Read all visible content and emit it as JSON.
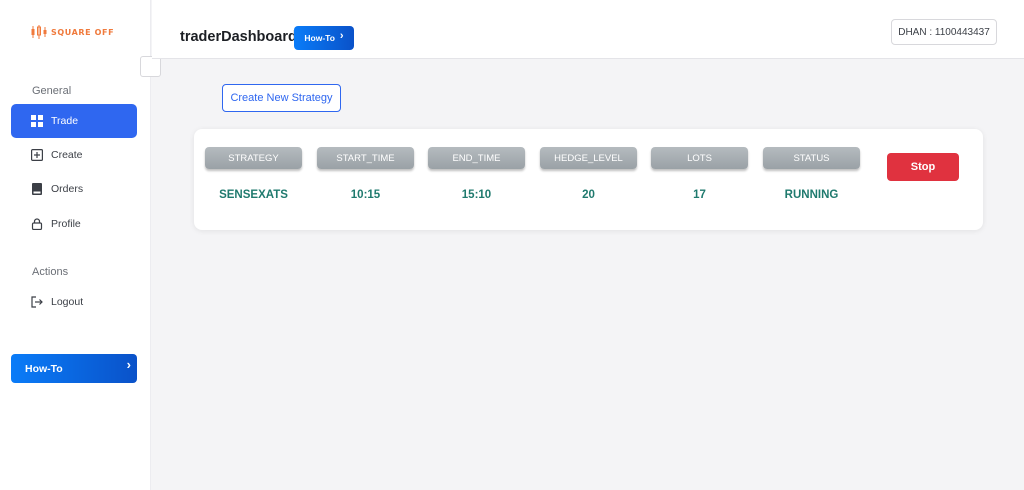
{
  "brand": {
    "name": "SQUARE OFF",
    "accent": "#f07a3c"
  },
  "sidebar": {
    "general_label": "General",
    "items": [
      {
        "label": "Trade",
        "icon": "grid-icon",
        "active": true
      },
      {
        "label": "Create",
        "icon": "plus-square-icon"
      },
      {
        "label": "Orders",
        "icon": "book-icon"
      },
      {
        "label": "Profile",
        "icon": "lock-icon"
      }
    ],
    "actions_label": "Actions",
    "logout_label": "Logout",
    "howto_label": "How-To"
  },
  "header": {
    "title": "traderDashboard",
    "howto_label": "How-To",
    "account": "DHAN : 1100443437"
  },
  "main": {
    "create_button": "Create New Strategy",
    "table": {
      "headers": [
        "STRATEGY",
        "START_TIME",
        "END_TIME",
        "HEDGE_LEVEL",
        "LOTS",
        "STATUS"
      ],
      "row": [
        "SENSEXATS",
        "10:15",
        "15:10",
        "20",
        "17",
        "RUNNING"
      ],
      "stop_label": "Stop"
    }
  },
  "colors": {
    "primary": "#2f67f0",
    "danger": "#e0323f",
    "value_text": "#1f7a6e"
  }
}
